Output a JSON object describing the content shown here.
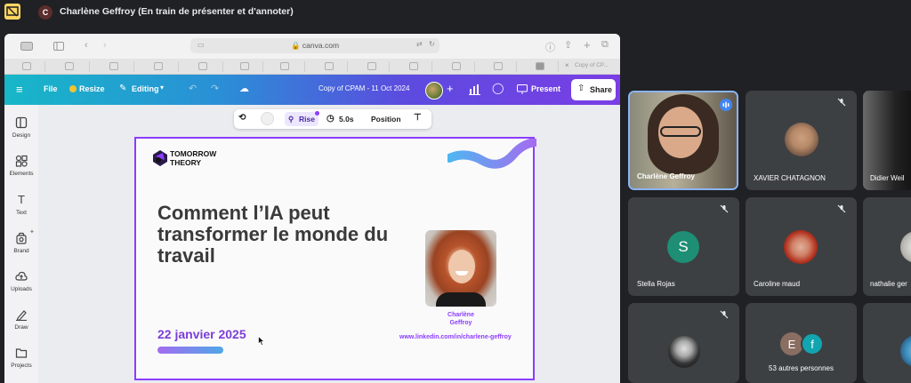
{
  "meet": {
    "presenter_initial": "C",
    "title": "Charlène Geffroy (En train de présenter et d'annoter)"
  },
  "browser": {
    "url": "canva.com",
    "last_tab_label": "Copy of CP..."
  },
  "canva": {
    "menu": {
      "file": "File",
      "resize": "Resize",
      "editing": "Editing"
    },
    "design_title": "Copy of CPAM - 11 Oct 2024",
    "present_label": "Present",
    "share_label": "Share",
    "anim_toolbar": {
      "effect": "Rise",
      "duration": "5.0s",
      "position": "Position"
    },
    "sidebar": [
      {
        "label": "Design",
        "icon": "design-icon"
      },
      {
        "label": "Elements",
        "icon": "elements-icon"
      },
      {
        "label": "Text",
        "icon": "text-icon"
      },
      {
        "label": "Brand",
        "icon": "brand-icon"
      },
      {
        "label": "Uploads",
        "icon": "uploads-icon"
      },
      {
        "label": "Draw",
        "icon": "draw-icon"
      },
      {
        "label": "Projects",
        "icon": "projects-icon"
      }
    ]
  },
  "slide": {
    "logo": "TOMORROW THEORY",
    "title": "Comment l’IA peut transformer le monde du travail",
    "date": "22 janvier 2025",
    "speaker_name_line1": "Charlène",
    "speaker_name_line2": "Geffroy",
    "link": "www.linkedin.com/in/charlene-geffroy"
  },
  "participants": [
    {
      "name": "Charlène Geffroy",
      "speaking": true
    },
    {
      "name": "XAVIER CHATAGNON",
      "muted": true
    },
    {
      "name": "Didier Weil"
    },
    {
      "name": "Stella Rojas",
      "initial": "S",
      "avatar_color": "#1e8e74",
      "muted": true
    },
    {
      "name": "Caroline maud",
      "muted": true
    },
    {
      "name": "nathalie ger"
    },
    {
      "name": "",
      "muted": true
    },
    {
      "name": "53 autres personnes",
      "initials": [
        "E",
        "f"
      ]
    },
    {
      "name": ""
    }
  ],
  "colors": {
    "meet_bg": "#202124",
    "tile_bg": "#3c4043",
    "canva_purple": "#8b3dff",
    "speaking_blue": "#4285f4"
  }
}
